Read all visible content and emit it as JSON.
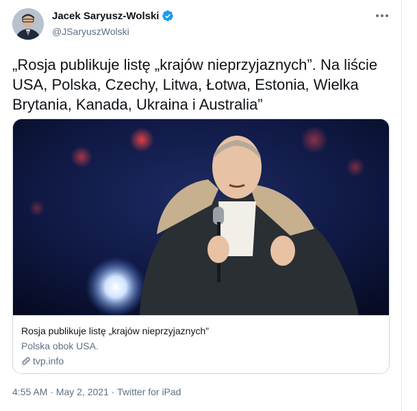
{
  "author": {
    "display_name": "Jacek Saryusz-Wolski",
    "handle": "@JSaryuszWolski",
    "verified_icon": "verified-badge-icon",
    "avatar_icon": "avatar"
  },
  "tweet": {
    "text": "„Rosja publikuje listę „krajów nieprzyjaznych”. Na liście USA, Polska, Czechy, Litwa, Łotwa, Estonia, Wielka Brytania, Kanada, Ukraina i Australia”"
  },
  "card": {
    "title": "Rosja publikuje listę „krajów nieprzyjaznych”",
    "description": "Polska obok USA.",
    "domain": "tvp.info",
    "link_icon": "link-icon"
  },
  "meta": {
    "time": "4:55 AM",
    "separator": " · ",
    "date": "May 2, 2021",
    "source": "Twitter for iPad"
  },
  "colors": {
    "text": "#0f1419",
    "secondary": "#5b7083",
    "verified": "#1d9bf0",
    "border": "#cfd9de"
  }
}
